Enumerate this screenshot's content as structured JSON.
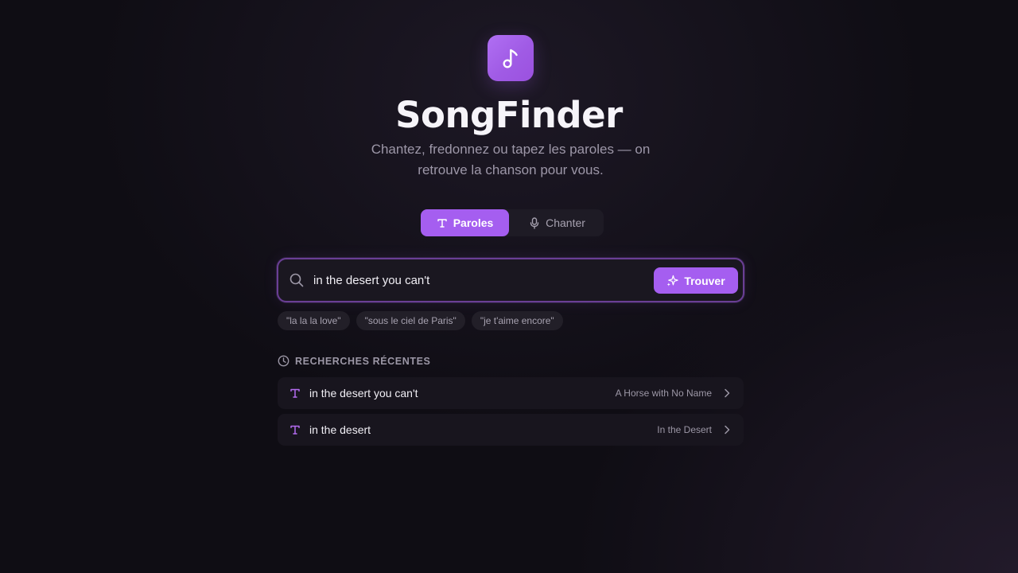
{
  "app": {
    "title": "SongFinder",
    "subtitle": "Chantez, fredonnez ou tapez les paroles — on retrouve la chanson pour vous.",
    "logo_icon": "music-note-icon"
  },
  "mode_toggle": {
    "options": [
      {
        "label": "Paroles",
        "icon": "text-icon",
        "active": true
      },
      {
        "label": "Chanter",
        "icon": "microphone-icon",
        "active": false
      }
    ]
  },
  "search": {
    "value": "in the desert you can't",
    "button_label": "Trouver",
    "button_icon": "sparkle-icon"
  },
  "suggestions": [
    "\"la la la love\"",
    "\"sous le ciel de Paris\"",
    "\"je t'aime encore\""
  ],
  "recent": {
    "header": "RECHERCHES RÉCENTES",
    "items": [
      {
        "query": "in the desert you can't",
        "song": "A Horse with No Name"
      },
      {
        "query": "in the desert",
        "song": "In the Desert"
      }
    ]
  },
  "colors": {
    "accent": "#a55ef0",
    "background": "#0f0d14"
  }
}
